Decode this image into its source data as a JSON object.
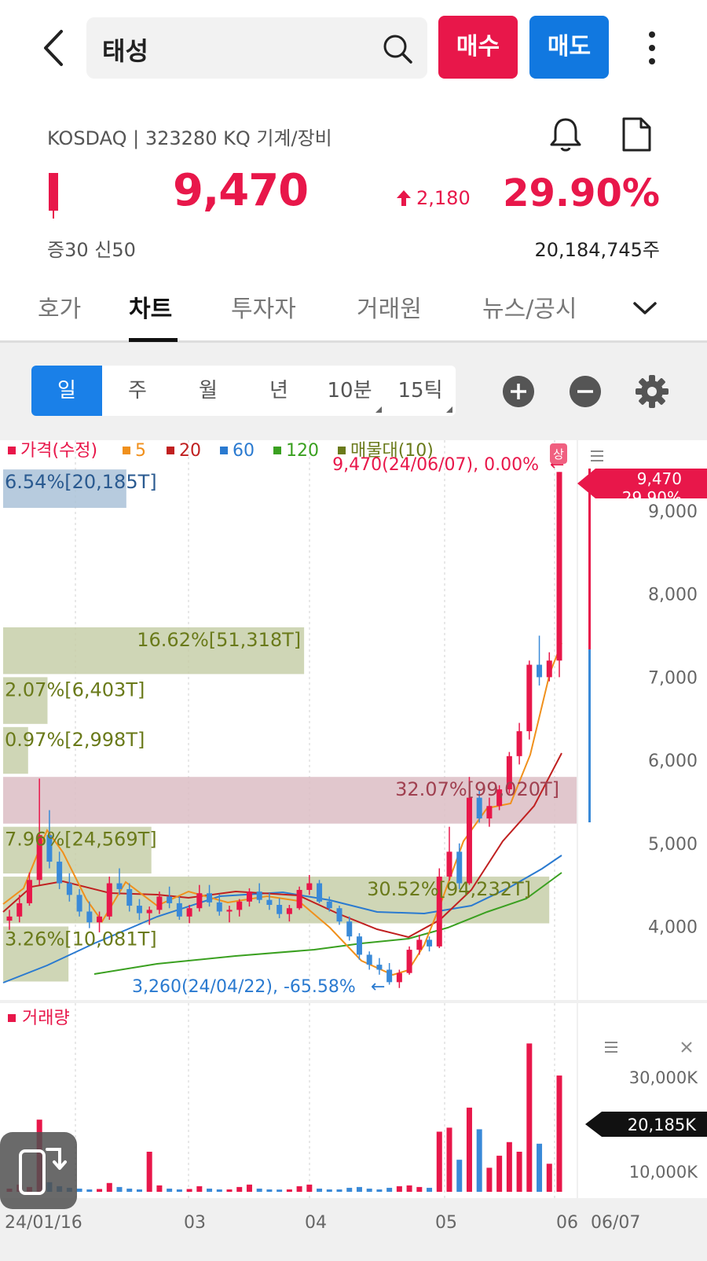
{
  "header": {
    "search_query": "태성",
    "buy_label": "매수",
    "sell_label": "매도"
  },
  "quote": {
    "market_info": "KOSDAQ | 323280 KQ 기계/장비",
    "price": "9,470",
    "change": "2,180",
    "change_pct": "29.90%",
    "margin_info": "증30   신50",
    "volume": "20,184,745주"
  },
  "tabs": [
    {
      "label": "호가"
    },
    {
      "label": "차트"
    },
    {
      "label": "투자자"
    },
    {
      "label": "거래원"
    },
    {
      "label": "뉴스/공시"
    }
  ],
  "periods": [
    {
      "label": "일"
    },
    {
      "label": "주"
    },
    {
      "label": "월"
    },
    {
      "label": "년"
    },
    {
      "label": "10분"
    },
    {
      "label": "15틱"
    }
  ],
  "colors": {
    "up": "#e8174a",
    "down": "#3a8ad8",
    "ma5": "#f0901c",
    "ma20": "#c02020",
    "ma60": "#2a7ad0",
    "ma120": "#3aa020",
    "volume_profile": "#6a7a1a"
  },
  "chart_data": {
    "type": "candlestick",
    "legend": [
      {
        "name": "가격(수정)",
        "color": "#e8174a"
      },
      {
        "name": "5",
        "color": "#f0901c"
      },
      {
        "name": "20",
        "color": "#c02020"
      },
      {
        "name": "60",
        "color": "#2a7ad0"
      },
      {
        "name": "120",
        "color": "#3aa020"
      },
      {
        "name": "매물대(10)",
        "color": "#6a7a1a"
      }
    ],
    "y_ticks": [
      "9,000",
      "8,000",
      "7,000",
      "6,000",
      "5,000",
      "4,000"
    ],
    "ylim": [
      3000,
      9700
    ],
    "x_ticks": [
      "24/01/16",
      "03",
      "04",
      "05",
      "06",
      "06/07"
    ],
    "max_annotation": "9,470(24/06/07), 0.00%",
    "min_annotation": "3,260(24/04/22), -65.58%",
    "upper_limit_badge": "상",
    "last_price_tag": {
      "price": "9,470",
      "pct": "29.90%"
    },
    "volume_profile": [
      {
        "label": "6.54%[20,185T]",
        "low": 9000,
        "high": 9500
      },
      {
        "label": "16.62%[51,318T]",
        "low": 7000,
        "high": 7600
      },
      {
        "label": "2.07%[6,403T]",
        "low": 6400,
        "high": 7000
      },
      {
        "label": "0.97%[2,998T]",
        "low": 5800,
        "high": 6400
      },
      {
        "label": "32.07%[99,020T]",
        "low": 5200,
        "high": 5800
      },
      {
        "label": "7.96%[24,569T]",
        "low": 4600,
        "high": 5200
      },
      {
        "label": "30.52%[94,232T]",
        "low": 4000,
        "high": 4600
      },
      {
        "label": "3.26%[10,081T]",
        "low": 3300,
        "high": 4000
      }
    ],
    "volume_panel": {
      "title": "거래량",
      "y_ticks": [
        "30,000K",
        "10,000K"
      ],
      "last_volume_tag": "20,185K"
    }
  }
}
